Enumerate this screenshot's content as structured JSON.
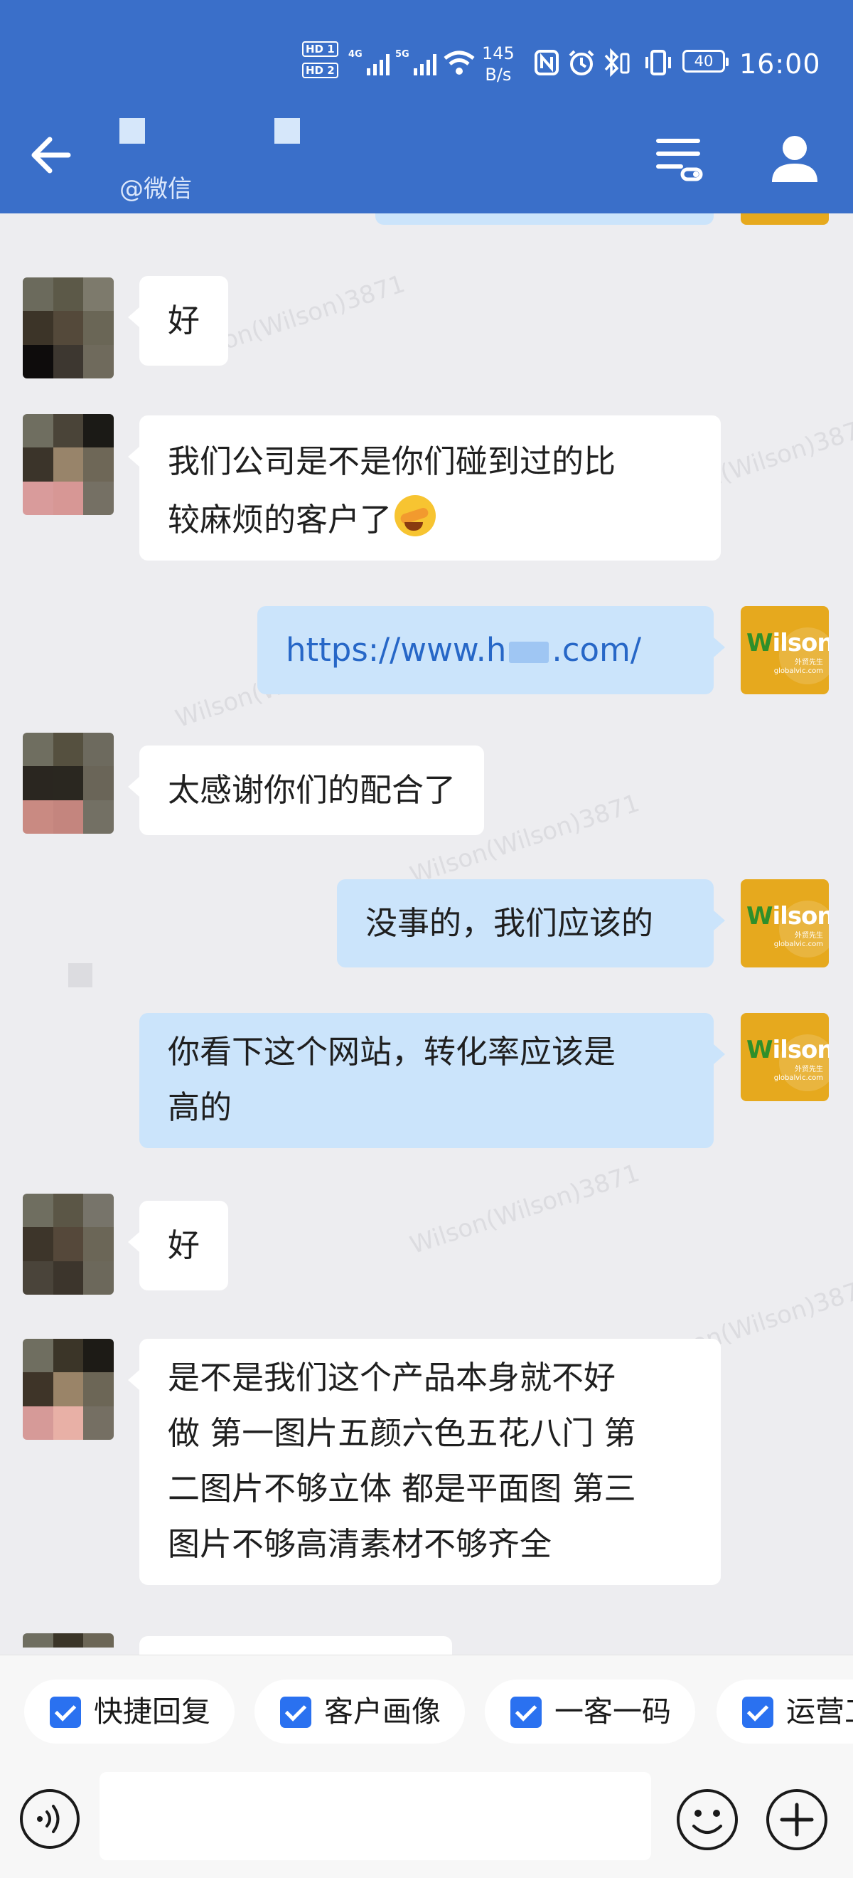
{
  "status_bar": {
    "hd_badges": [
      "HD 1",
      "HD 2"
    ],
    "net_speed_value": "145",
    "net_speed_unit": "B/s",
    "battery": "40",
    "time": "16:00"
  },
  "header": {
    "contact_source": "@微信",
    "colors": {
      "background": "#3a6fc9"
    }
  },
  "watermark_text": "Wilson(Wilson)3871",
  "my_avatar": {
    "logo_green": "W",
    "logo_white": "ilson",
    "sub_line1": "外贸先生",
    "sub_line2": "globalvic.com"
  },
  "messages": [
    {
      "side": "left",
      "text": "好"
    },
    {
      "side": "left",
      "line1": "我们公司是不是你们碰到过的比",
      "line2": "较麻烦的客户了",
      "emoji": "facepalm-laugh"
    },
    {
      "side": "right",
      "link_text": "https://www.h",
      "link_tail": ".com/"
    },
    {
      "side": "left",
      "text": "太感谢你们的配合了"
    },
    {
      "side": "right",
      "text": "没事的，我们应该的"
    },
    {
      "side": "right",
      "line1": "你看下这个网站，转化率应该是",
      "line2": "高的"
    },
    {
      "side": "left",
      "text": "好"
    },
    {
      "side": "left",
      "lines": [
        "是不是我们这个产品本身就不好",
        "做 第一图片五颜六色五花八门 第",
        "二图片不够立体 都是平面图 第三",
        "图片不够高清素材不够齐全"
      ]
    }
  ],
  "quick_actions": [
    "快捷回复",
    "客户画像",
    "一客一码",
    "运营工"
  ],
  "input": {
    "placeholder": ""
  },
  "colors": {
    "accent": "#2a71f0",
    "bubble_me": "#cbe4fb",
    "bubble_other": "#ffffff",
    "background": "#ededf0"
  }
}
